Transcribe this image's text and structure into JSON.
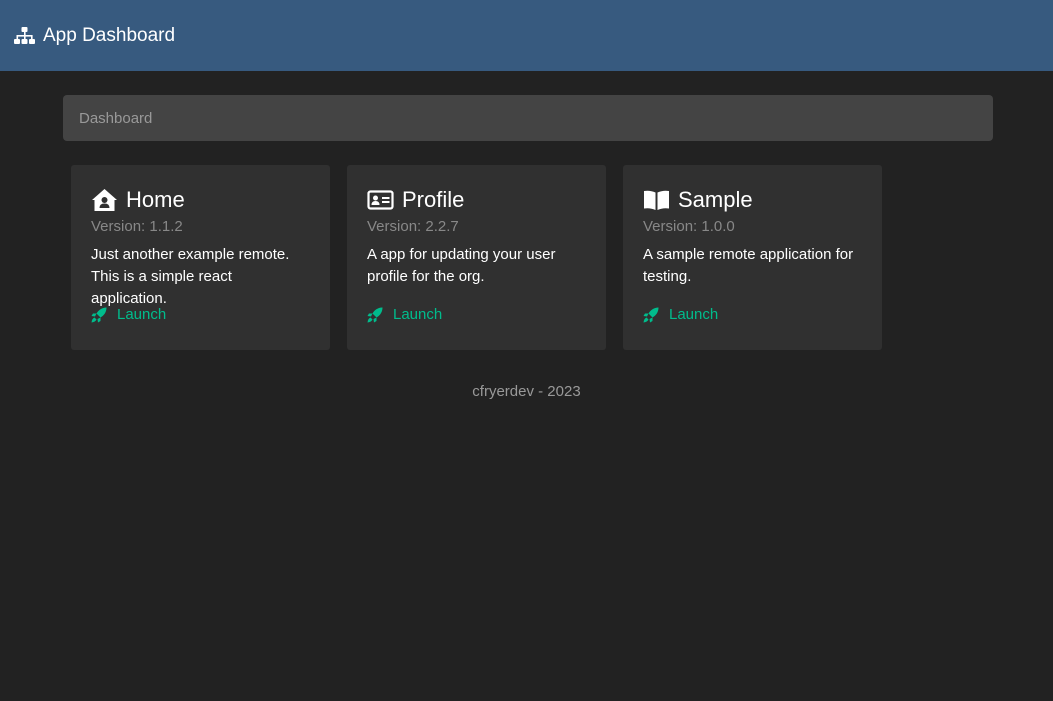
{
  "navbar": {
    "title": "App Dashboard",
    "icon": "sitemap-icon"
  },
  "breadcrumb": {
    "items": [
      "Dashboard"
    ]
  },
  "apps": [
    {
      "icon": "house-user-icon",
      "title": "Home",
      "version": "Version: 1.1.2",
      "description": "Just another example remote. This is a simple react application.",
      "launch_label": "Launch"
    },
    {
      "icon": "id-card-icon",
      "title": "Profile",
      "version": "Version: 2.2.7",
      "description": "A app for updating your user profile for the org.",
      "launch_label": "Launch"
    },
    {
      "icon": "book-open-icon",
      "title": "Sample",
      "version": "Version: 1.0.0",
      "description": "A sample remote application for testing.",
      "launch_label": "Launch"
    }
  ],
  "footer": {
    "text": "cfryerdev - 2023"
  },
  "colors": {
    "navbar": "#375a7f",
    "background": "#222222",
    "card": "#303030",
    "accent": "#00bc8c"
  }
}
